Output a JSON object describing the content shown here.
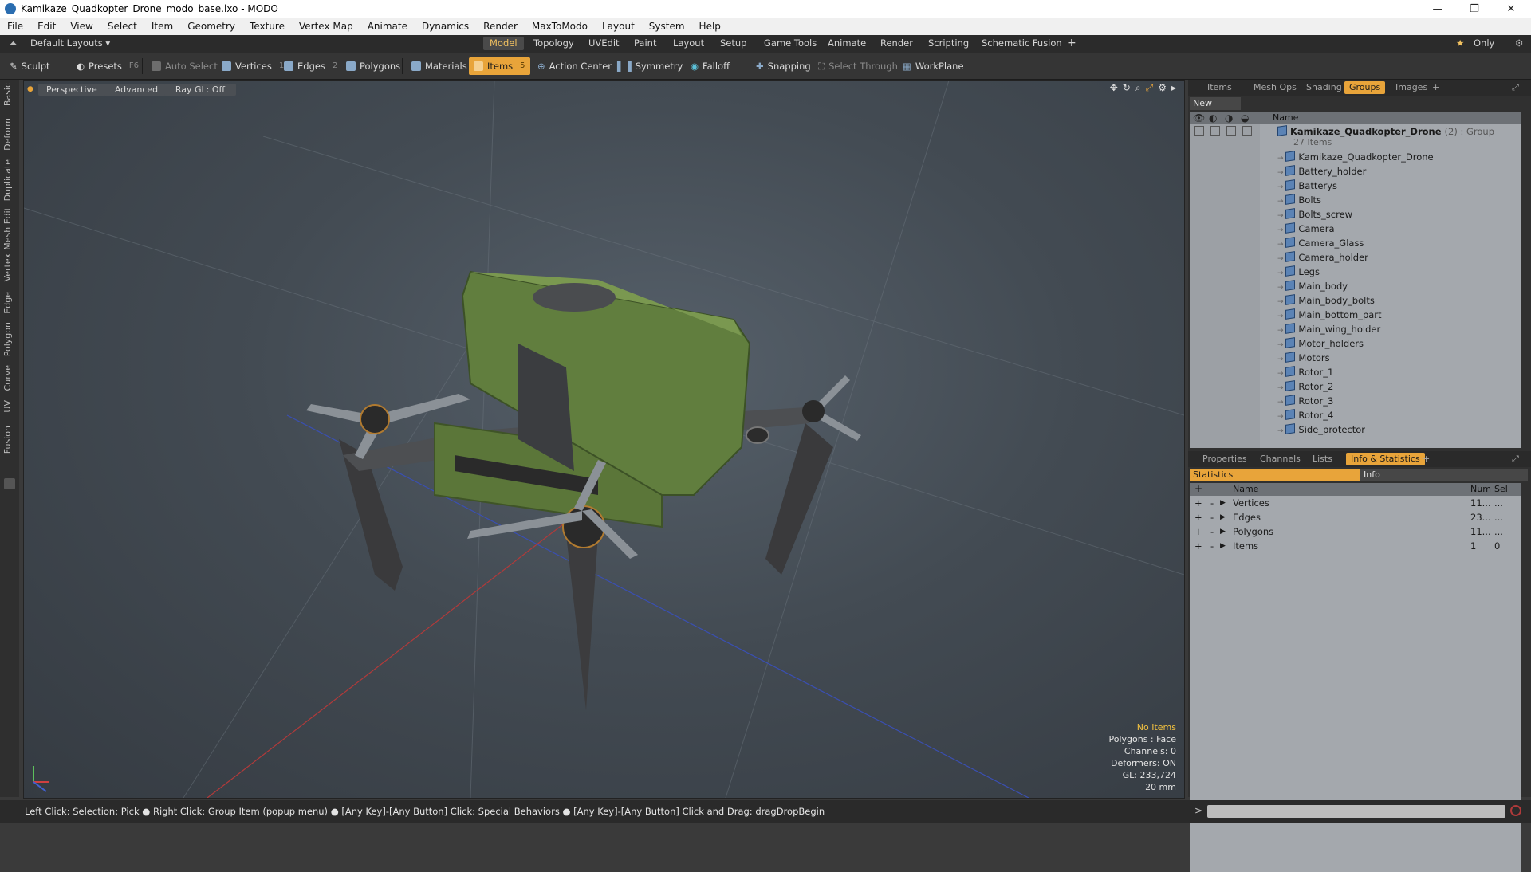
{
  "window": {
    "title": "Kamikaze_Quadkopter_Drone_modo_base.lxo - MODO"
  },
  "menu": [
    "File",
    "Edit",
    "View",
    "Select",
    "Item",
    "Geometry",
    "Texture",
    "Vertex Map",
    "Animate",
    "Dynamics",
    "Render",
    "MaxToModo",
    "Layout",
    "System",
    "Help"
  ],
  "layout": {
    "selector": "Default Layouts ▾",
    "tabs": [
      "Model",
      "Topology",
      "UVEdit",
      "Paint",
      "Layout",
      "Setup",
      "Game Tools",
      "Animate",
      "Render",
      "Scripting",
      "Schematic Fusion"
    ],
    "only": "Only"
  },
  "toolbar": {
    "sculpt": "Sculpt",
    "presets": "Presets",
    "presets_key": "F6",
    "auto_select": "Auto Select",
    "vertices": "Vertices",
    "vertices_key": "1",
    "edges": "Edges",
    "edges_key": "2",
    "polygons": "Polygons",
    "materials": "Materials",
    "items": "Items",
    "items_key": "5",
    "action_center": "Action Center",
    "symmetry": "Symmetry",
    "falloff": "Falloff",
    "snapping": "Snapping",
    "select_through": "Select Through",
    "workplane": "WorkPlane"
  },
  "lefttabs": [
    "Basic",
    "Deform",
    "Duplicate",
    "Mesh Edit",
    "Vertex",
    "Edge",
    "Polygon",
    "Curve",
    "UV",
    "Fusion"
  ],
  "viewport": {
    "perspective": "Perspective",
    "advanced": "Advanced",
    "raygl": "Ray GL: Off",
    "info": {
      "no_items": "No Items",
      "polygons": "Polygons : Face",
      "channels": "Channels: 0",
      "deformers": "Deformers: ON",
      "gl": "GL: 233,724",
      "scale": "20 mm"
    }
  },
  "groups_panel": {
    "tabs": [
      "Items",
      "Mesh Ops",
      "Shading",
      "Groups",
      "Images"
    ],
    "new_group": "New Group",
    "name_header": "Name",
    "group_name": "Kamikaze_Quadkopter_Drone",
    "group_suffix": "(2) : Group",
    "item_count": "27 Items",
    "items": [
      "Kamikaze_Quadkopter_Drone",
      "Battery_holder",
      "Batterys",
      "Bolts",
      "Bolts_screw",
      "Camera",
      "Camera_Glass",
      "Camera_holder",
      "Legs",
      "Main_body",
      "Main_body_bolts",
      "Main_bottom_part",
      "Main_wing_holder",
      "Motor_holders",
      "Motors",
      "Rotor_1",
      "Rotor_2",
      "Rotor_3",
      "Rotor_4",
      "Side_protector"
    ]
  },
  "stats_panel": {
    "tabs": [
      "Properties",
      "Channels",
      "Lists",
      "Info & Statistics"
    ],
    "subtabs": [
      "Statistics",
      "Info"
    ],
    "headers": {
      "name": "Name",
      "num": "Num",
      "sel": "Sel"
    },
    "rows": [
      {
        "name": "Vertices",
        "num": "11...",
        "sel": "..."
      },
      {
        "name": "Edges",
        "num": "23...",
        "sel": "..."
      },
      {
        "name": "Polygons",
        "num": "11...",
        "sel": "..."
      },
      {
        "name": "Items",
        "num": "1",
        "sel": "0"
      }
    ]
  },
  "status": "Left Click: Selection: Pick ● Right Click: Group Item (popup menu) ● [Any Key]-[Any Button] Click: Special Behaviors ● [Any Key]-[Any Button] Click and Drag: dragDropBegin",
  "colors": {
    "accent": "#e8a43a",
    "drone_green": "#5f7a3e",
    "panel_bg": "#303030"
  }
}
